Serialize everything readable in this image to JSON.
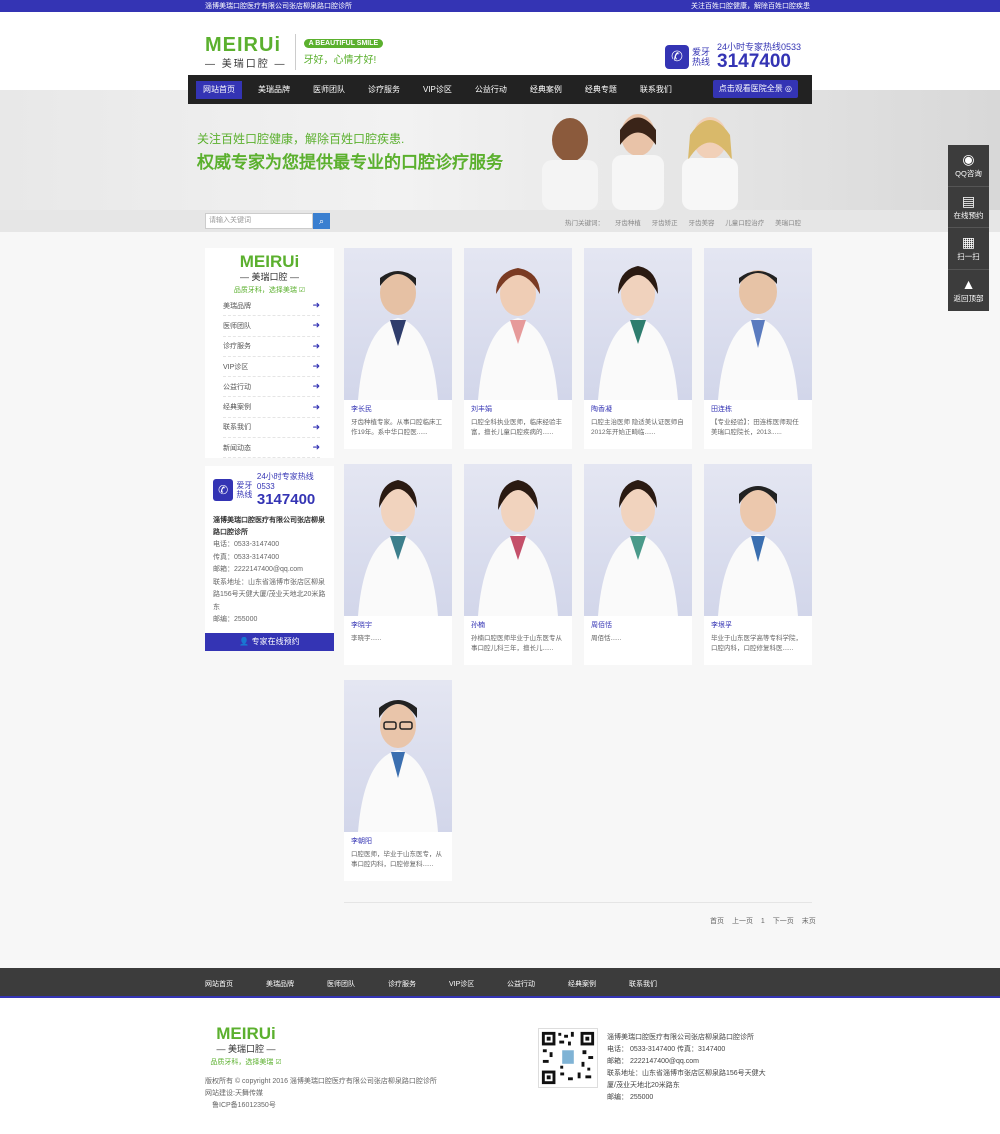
{
  "topbar": {
    "left": "淄博美瑞口腔医疗有限公司张店柳泉路口腔诊所",
    "right": "关注百姓口腔健康，解除百姓口腔疾患"
  },
  "header": {
    "logo_en": "MEIRUi",
    "logo_cn": "美瑞口腔",
    "logo_badge": "A BEAUTIFUL SMILE",
    "logo_slogan": "牙好，心情才好!",
    "hotline_label": "爱牙热线",
    "hotline_title": "24小时专家热线0533",
    "hotline_number": "3147400"
  },
  "nav": {
    "items": [
      "网站首页",
      "美瑞品牌",
      "医师团队",
      "诊疗服务",
      "VIP诊区",
      "公益行动",
      "经典案例",
      "经典专题",
      "联系我们"
    ],
    "book": "点击观看医院全景"
  },
  "banner": {
    "line1": "关注百姓口腔健康，解除百姓口腔疾患.",
    "line2": "权威专家为您提供最专业的口腔诊疗服务"
  },
  "search": {
    "placeholder": "请输入关键词",
    "hot_label": "热门关键词：",
    "keywords": [
      "牙齿种植",
      "牙齿矫正",
      "牙齿美容",
      "儿童口腔治疗",
      "美瑞口腔"
    ]
  },
  "side": {
    "logo_en": "MEIRUi",
    "logo_cn": "美瑞口腔",
    "slogan": "品质牙科，选择美瑞",
    "menu": [
      "美瑞品牌",
      "医师团队",
      "诊疗服务",
      "VIP诊区",
      "公益行动",
      "经典案例",
      "联系我们",
      "新闻动态"
    ],
    "hotline_label": "爱牙热线",
    "hotline_title": "24小时专家热线0533",
    "hotline_number": "3147400",
    "company": "淄博美瑞口腔医疗有限公司张店柳泉路口腔诊所",
    "tel": "电话：0533-3147400",
    "fax": "传真：0533-3147400",
    "email": "邮箱：2222147400@qq.com",
    "address": "联系地址：山东省淄博市张店区柳泉路156号天健大厦/茂业天地北20米路东",
    "postcode": "邮编：255000",
    "book": "专家在线预约"
  },
  "doctors": [
    {
      "name": "李长民",
      "desc": "牙齿种植专家。从事口腔临床工作19年。系中华口腔医......"
    },
    {
      "name": "刘丰娟",
      "desc": "口腔全科执业医师，临床经验丰富，擅长儿童口腔疾病的......"
    },
    {
      "name": "陶香凝",
      "desc": "口腔主治医师 隐适美认证医师自2012年开始正畸临......"
    },
    {
      "name": "田连栋",
      "desc": "【专业经验】：田连栋医师现任美瑞口腔院长，2013......"
    },
    {
      "name": "李晓宇",
      "desc": "李晓宇......"
    },
    {
      "name": "孙楠",
      "desc": "孙楠口腔医师毕业于山东医专从事口腔儿科三年，擅长儿......"
    },
    {
      "name": "周佰恬",
      "desc": "周佰恬......"
    },
    {
      "name": "李垠孚",
      "desc": "毕业于山东医学高等专科学院，口腔内科，口腔修复科医......"
    },
    {
      "name": "李朝阳",
      "desc": "口腔医师，毕业于山东医专，从事口腔内科，口腔修复科......"
    }
  ],
  "pager": [
    "首页",
    "上一页",
    "1",
    "下一页",
    "末页"
  ],
  "footer_nav": [
    "网站首页",
    "美瑞品牌",
    "医师团队",
    "诊疗服务",
    "VIP诊区",
    "公益行动",
    "经典案例",
    "联系我们"
  ],
  "footer": {
    "logo_en": "MEIRUi",
    "logo_cn": "美瑞口腔",
    "slogan": "品质牙科，选择美瑞",
    "copyright": "版权所有 © copyright 2016 淄博美瑞口腔医疗有限公司张店柳泉路口腔诊所",
    "builder": "网站建设:天舞传媒",
    "icp": "鲁ICP备16012350号",
    "company": "淄博美瑞口腔医疗有限公司张店柳泉路口腔诊所",
    "tel": "电话：  0533-3147400    传真：3147400",
    "email": "邮箱：  2222147400@qq.com",
    "address": "联系地址：山东省淄博市张店区柳泉路156号天健大厦/茂业天地北20米路东",
    "postcode": "邮编：  255000"
  },
  "float": [
    "QQ咨询",
    "在线预约",
    "扫一扫",
    "返回顶部"
  ],
  "colors": {
    "brand": "#3434b4",
    "green": "#5bb02e"
  }
}
